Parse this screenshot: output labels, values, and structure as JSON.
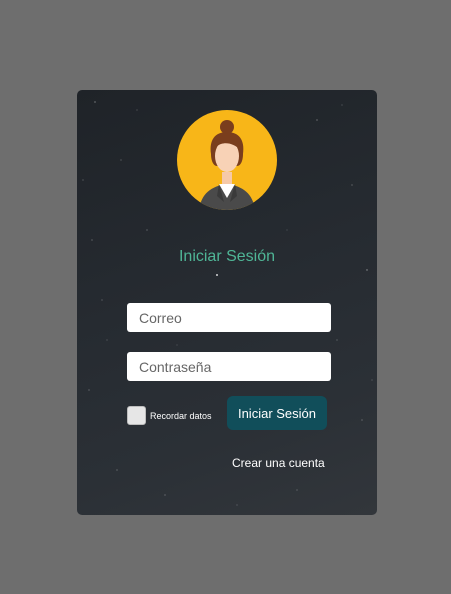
{
  "login": {
    "title": "Iniciar Sesión",
    "email_placeholder": "Correo",
    "password_placeholder": "Contraseña",
    "remember_label": "Recordar datos",
    "submit_label": "Iniciar Sesión",
    "create_account_label": "Crear una cuenta",
    "remember_checked": false
  },
  "icons": {
    "avatar": "user-avatar-icon"
  },
  "colors": {
    "page_background": "#6e6e6e",
    "card_background": "#23282d",
    "title_text": "#4fb596",
    "button_background": "#114e5a",
    "avatar_circle": "#f8b618"
  }
}
